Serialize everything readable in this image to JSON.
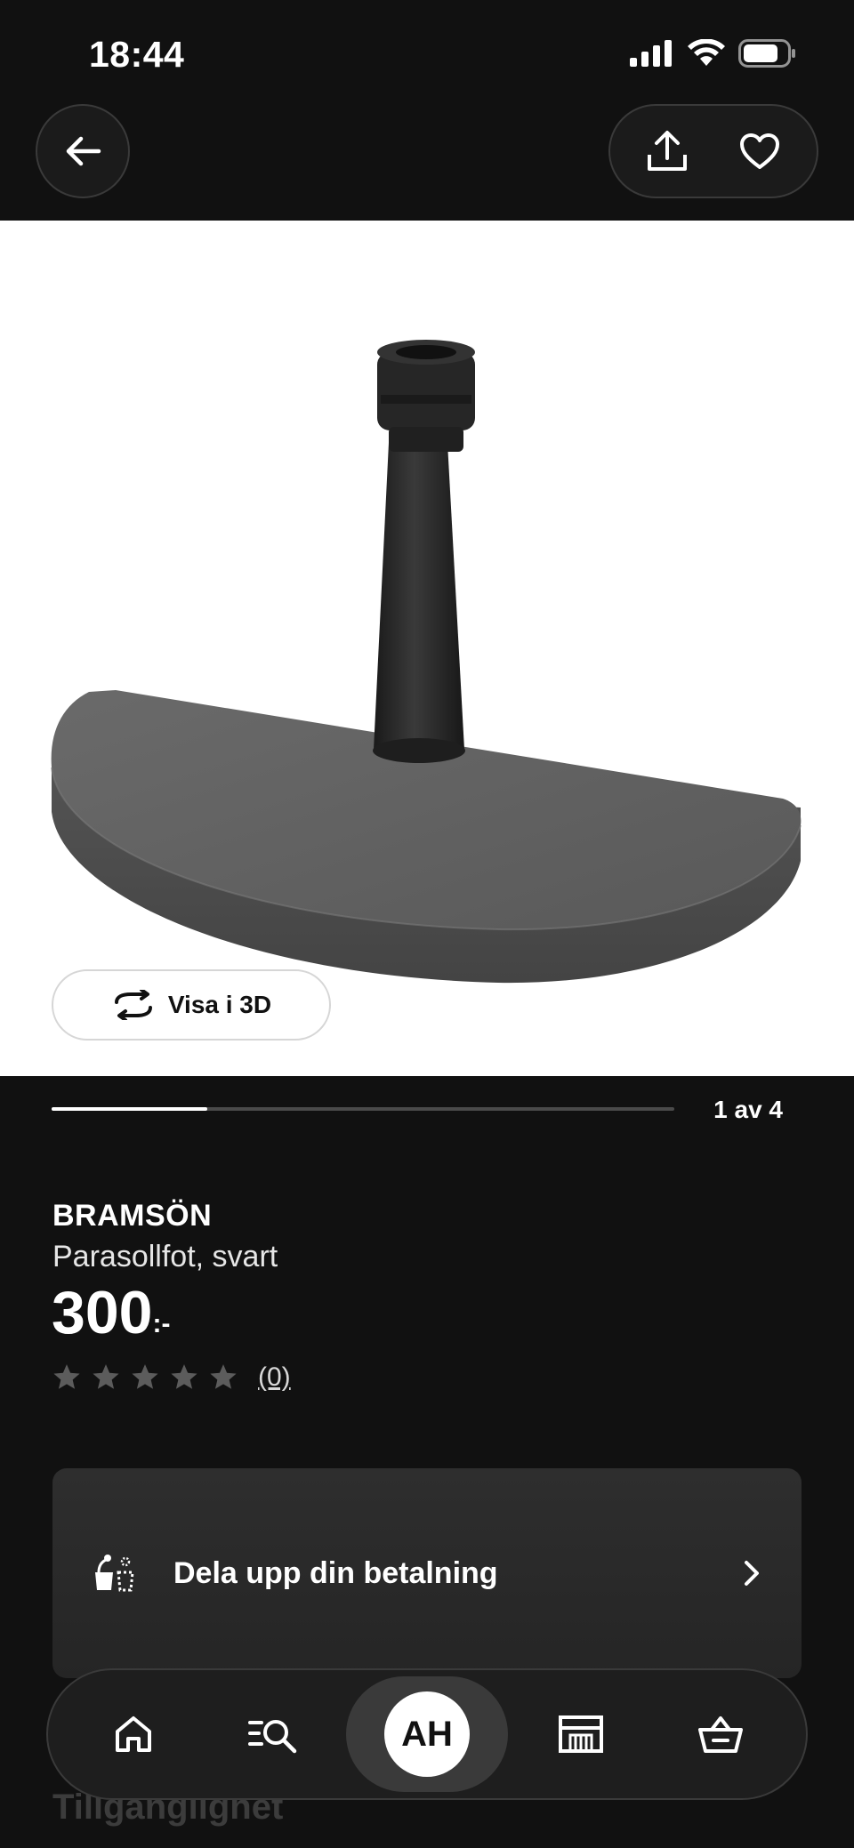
{
  "status_bar": {
    "time": "18:44",
    "icons": [
      "cellular-signal-icon",
      "wifi-icon",
      "battery-icon"
    ]
  },
  "header": {
    "back_icon": "arrow-left-icon",
    "share_icon": "share-upload-icon",
    "favorite_icon": "heart-outline-icon"
  },
  "gallery": {
    "view_3d_label": "Visa i 3D",
    "view_3d_icon": "rotate-3d-icon",
    "current_image": 1,
    "total_images": 4,
    "progress": 0.25,
    "position_label": "1 av 4"
  },
  "product": {
    "name": "BRAMSÖN",
    "description": "Parasollfot, svart",
    "price": "300",
    "price_suffix": ":-",
    "rating_value": 0,
    "rating_max": 5,
    "review_count": "(0)"
  },
  "installment": {
    "label": "Dela upp din betalning",
    "icon": "payment-split-icon",
    "chevron_icon": "chevron-right-icon"
  },
  "partially_hidden_heading": "Tillgänglighet",
  "tab_bar": {
    "tabs": [
      {
        "name": "home",
        "icon": "home-icon",
        "active": false
      },
      {
        "name": "search",
        "icon": "search-list-icon",
        "active": false
      },
      {
        "name": "profile",
        "avatar_initials": "AH",
        "active": true
      },
      {
        "name": "store",
        "icon": "store-icon",
        "active": false
      },
      {
        "name": "cart",
        "icon": "shopping-basket-icon",
        "active": false
      }
    ]
  },
  "colors": {
    "background": "#111111",
    "card": "#2a2a2a",
    "text": "#ffffff",
    "product_base": "#5a5a5a",
    "product_pole": "#222222"
  }
}
